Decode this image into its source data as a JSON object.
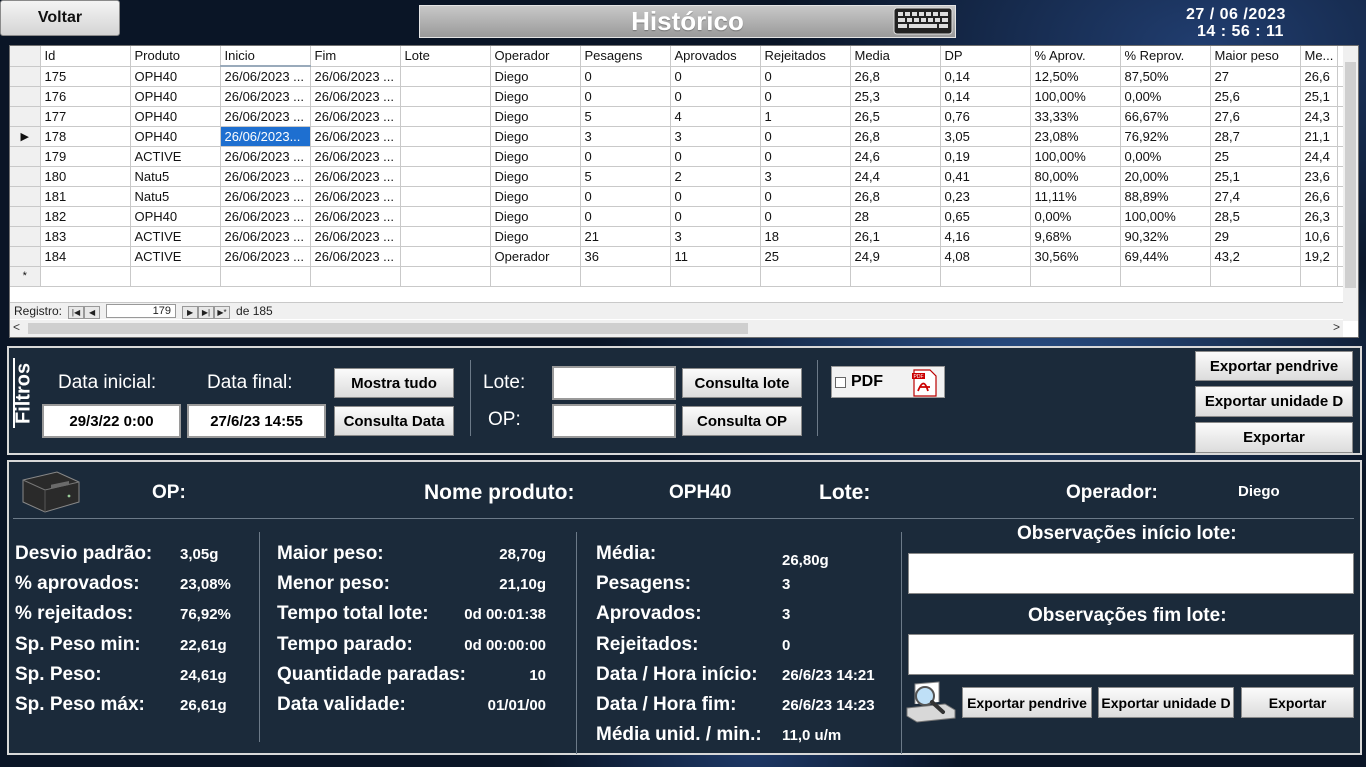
{
  "header": {
    "back_label": "Voltar",
    "title": "Histórico",
    "date": "27 / 06 /2023",
    "time": "14 : 56 : 11"
  },
  "grid": {
    "columns": [
      "Id",
      "Produto",
      "Inicio",
      "Fim",
      "Lote",
      "Operador",
      "Pesagens",
      "Aprovados",
      "Rejeitados",
      "Media",
      "DP",
      "% Aprov.",
      "% Reprov.",
      "Maior peso",
      "Me..."
    ],
    "rows": [
      [
        "175",
        "OPH40",
        "26/06/2023 ...",
        "26/06/2023 ...",
        "",
        "Diego",
        "0",
        "0",
        "0",
        "26,8",
        "0,14",
        "12,50%",
        "87,50%",
        "27",
        "26,6"
      ],
      [
        "176",
        "OPH40",
        "26/06/2023 ...",
        "26/06/2023 ...",
        "",
        "Diego",
        "0",
        "0",
        "0",
        "25,3",
        "0,14",
        "100,00%",
        "0,00%",
        "25,6",
        "25,1"
      ],
      [
        "177",
        "OPH40",
        "26/06/2023 ...",
        "26/06/2023 ...",
        "",
        "Diego",
        "5",
        "4",
        "1",
        "26,5",
        "0,76",
        "33,33%",
        "66,67%",
        "27,6",
        "24,3"
      ],
      [
        "178",
        "OPH40",
        "26/06/2023...",
        "26/06/2023 ...",
        "",
        "Diego",
        "3",
        "3",
        "0",
        "26,8",
        "3,05",
        "23,08%",
        "76,92%",
        "28,7",
        "21,1"
      ],
      [
        "179",
        "ACTIVE",
        "26/06/2023 ...",
        "26/06/2023 ...",
        "",
        "Diego",
        "0",
        "0",
        "0",
        "24,6",
        "0,19",
        "100,00%",
        "0,00%",
        "25",
        "24,4"
      ],
      [
        "180",
        "Natu5",
        "26/06/2023 ...",
        "26/06/2023 ...",
        "",
        "Diego",
        "5",
        "2",
        "3",
        "24,4",
        "0,41",
        "80,00%",
        "20,00%",
        "25,1",
        "23,6"
      ],
      [
        "181",
        "Natu5",
        "26/06/2023 ...",
        "26/06/2023 ...",
        "",
        "Diego",
        "0",
        "0",
        "0",
        "26,8",
        "0,23",
        "11,11%",
        "88,89%",
        "27,4",
        "26,6"
      ],
      [
        "182",
        "OPH40",
        "26/06/2023 ...",
        "26/06/2023 ...",
        "",
        "Diego",
        "0",
        "0",
        "0",
        "28",
        "0,65",
        "0,00%",
        "100,00%",
        "28,5",
        "26,3"
      ],
      [
        "183",
        "ACTIVE",
        "26/06/2023 ...",
        "26/06/2023 ...",
        "",
        "Diego",
        "21",
        "3",
        "18",
        "26,1",
        "4,16",
        "9,68%",
        "90,32%",
        "29",
        "10,6"
      ],
      [
        "184",
        "ACTIVE",
        "26/06/2023 ...",
        "26/06/2023 ...",
        "",
        "Operador",
        "36",
        "11",
        "25",
        "24,9",
        "4,08",
        "30,56%",
        "69,44%",
        "43,2",
        "19,2"
      ]
    ],
    "current_row_index": 3,
    "new_row_marker": "*",
    "current_row_marker": "▶",
    "nav": {
      "label": "Registro:",
      "current": "179",
      "of_text": "de 185"
    }
  },
  "filters": {
    "section_label": "Filtros",
    "data_inicial_label": "Data inicial:",
    "data_final_label": "Data final:",
    "data_inicial_value": "29/3/22 0:00",
    "data_final_value": "27/6/23 14:55",
    "mostra_tudo": "Mostra tudo",
    "consulta_data": "Consulta Data",
    "lote_label": "Lote:",
    "op_label": "OP:",
    "lote_value": "",
    "op_value": "",
    "consulta_lote": "Consulta lote",
    "consulta_op": "Consulta OP",
    "pdf_label": "PDF",
    "pdf_checked": false,
    "exportar_pendrive": "Exportar pendrive",
    "exportar_unidade": "Exportar unidade D",
    "exportar": "Exportar"
  },
  "detail": {
    "op_label": "OP:",
    "op_value": "",
    "nome_produto_label": "Nome produto:",
    "nome_produto_value": "OPH40",
    "lote_label": "Lote:",
    "lote_value": "",
    "operador_label": "Operador:",
    "operador_value": "Diego",
    "col1": [
      {
        "label": "Desvio padrão:",
        "value": "3,05g"
      },
      {
        "label": "% aprovados:",
        "value": "23,08%"
      },
      {
        "label": "% rejeitados:",
        "value": "76,92%"
      },
      {
        "label": "Sp. Peso min:",
        "value": "22,61g"
      },
      {
        "label": "Sp. Peso:",
        "value": "24,61g"
      },
      {
        "label": "Sp. Peso máx:",
        "value": "26,61g"
      }
    ],
    "col2": [
      {
        "label": "Maior peso:",
        "value": "28,70g"
      },
      {
        "label": "Menor peso:",
        "value": "21,10g"
      },
      {
        "label": "Tempo total lote:",
        "value": "0d 00:01:38"
      },
      {
        "label": "Tempo parado:",
        "value": "0d 00:00:00"
      },
      {
        "label": "Quantidade paradas:",
        "value": "10"
      },
      {
        "label": "Data validade:",
        "value": "01/01/00"
      }
    ],
    "col3": [
      {
        "label": "Média:",
        "value": "26,80g"
      },
      {
        "label": "Pesagens:",
        "value": "3"
      },
      {
        "label": "Aprovados:",
        "value": "3"
      },
      {
        "label": "Rejeitados:",
        "value": "0"
      },
      {
        "label": "Data / Hora início:",
        "value": "26/6/23 14:21"
      },
      {
        "label": "Data / Hora fim:",
        "value": "26/6/23 14:23"
      },
      {
        "label": "Média unid. / min.:",
        "value": "11,0 u/m"
      }
    ],
    "obs_inicio_label": "Observações início lote:",
    "obs_fim_label": "Observações fim lote:",
    "obs_inicio_value": "",
    "obs_fim_value": "",
    "exportar_pendrive": "Exportar pendrive",
    "exportar_unidade": "Exportar unidade D",
    "exportar": "Exportar"
  }
}
